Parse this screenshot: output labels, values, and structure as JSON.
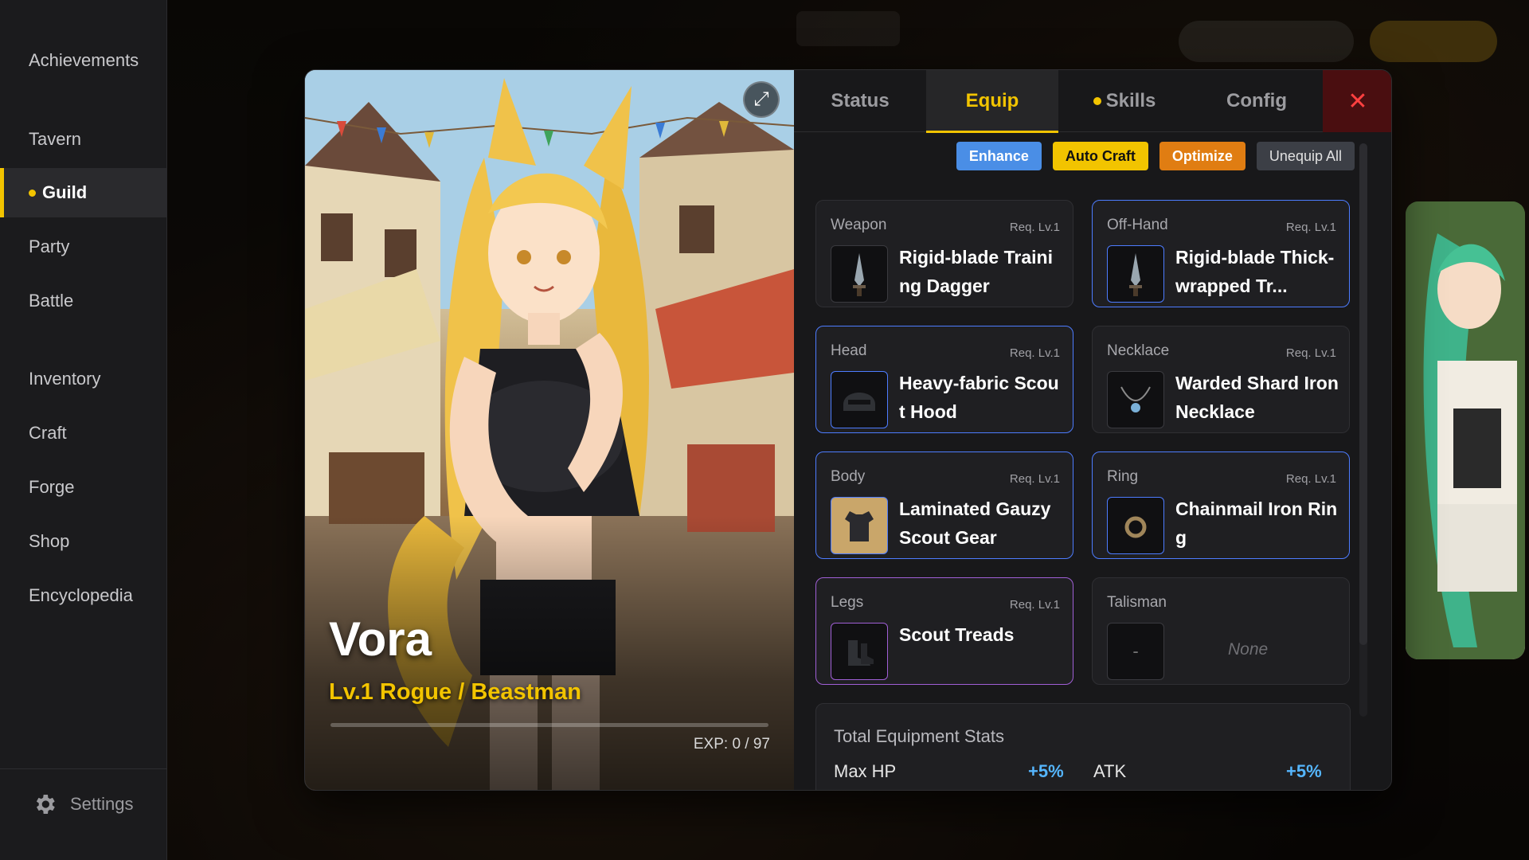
{
  "sidebar": {
    "items": [
      {
        "label": "Achievements"
      },
      {
        "label": "Tavern"
      },
      {
        "label": "Guild"
      },
      {
        "label": "Party"
      },
      {
        "label": "Battle"
      },
      {
        "label": "Inventory"
      },
      {
        "label": "Craft"
      },
      {
        "label": "Forge"
      },
      {
        "label": "Shop"
      },
      {
        "label": "Encyclopedia"
      }
    ],
    "active": "Guild",
    "settings_label": "Settings"
  },
  "character": {
    "name": "Vora",
    "class_line": "Lv.1 Rogue / Beastman",
    "exp_text": "EXP: 0 / 97",
    "exp_fraction": 0.0
  },
  "tabs": [
    {
      "label": "Status"
    },
    {
      "label": "Equip"
    },
    {
      "label": "Skills"
    },
    {
      "label": "Config"
    }
  ],
  "active_tab": "Equip",
  "close_label": "✕",
  "actions": {
    "enhance": "Enhance",
    "auto_craft": "Auto Craft",
    "optimize": "Optimize",
    "unequip_all": "Unequip All"
  },
  "slots": [
    {
      "slot": "Weapon",
      "req": "Req. Lv.1",
      "name": "Rigid-blade Training Dagger",
      "icon": "dagger-icon"
    },
    {
      "slot": "Off-Hand",
      "req": "Req. Lv.1",
      "name": "Rigid-blade Thick-wrapped Tr...",
      "icon": "dagger-icon"
    },
    {
      "slot": "Head",
      "req": "Req. Lv.1",
      "name": "Heavy-fabric Scout Hood",
      "icon": "helmet-icon"
    },
    {
      "slot": "Necklace",
      "req": "Req. Lv.1",
      "name": "Warded Shard Iron Necklace",
      "icon": "necklace-icon"
    },
    {
      "slot": "Body",
      "req": "Req. Lv.1",
      "name": "Laminated Gauzy Scout Gear",
      "icon": "armor-icon"
    },
    {
      "slot": "Ring",
      "req": "Req. Lv.1",
      "name": "Chainmail Iron Ring",
      "icon": "ring-icon"
    },
    {
      "slot": "Legs",
      "req": "Req. Lv.1",
      "name": "Scout Treads",
      "icon": "boots-icon"
    },
    {
      "slot": "Talisman",
      "req": "",
      "name": "None",
      "icon": "empty-icon",
      "empty_mark": "-"
    }
  ],
  "stats": {
    "title": "Total Equipment Stats",
    "rows": [
      {
        "label": "Max HP",
        "value": "+5%"
      },
      {
        "label": "ATK",
        "value": "+5%"
      }
    ]
  },
  "colors": {
    "accent": "#f2c400",
    "rare_border": "#4d7cff",
    "epic_border": "#a05fd6",
    "stat_value": "#55b6ff"
  }
}
